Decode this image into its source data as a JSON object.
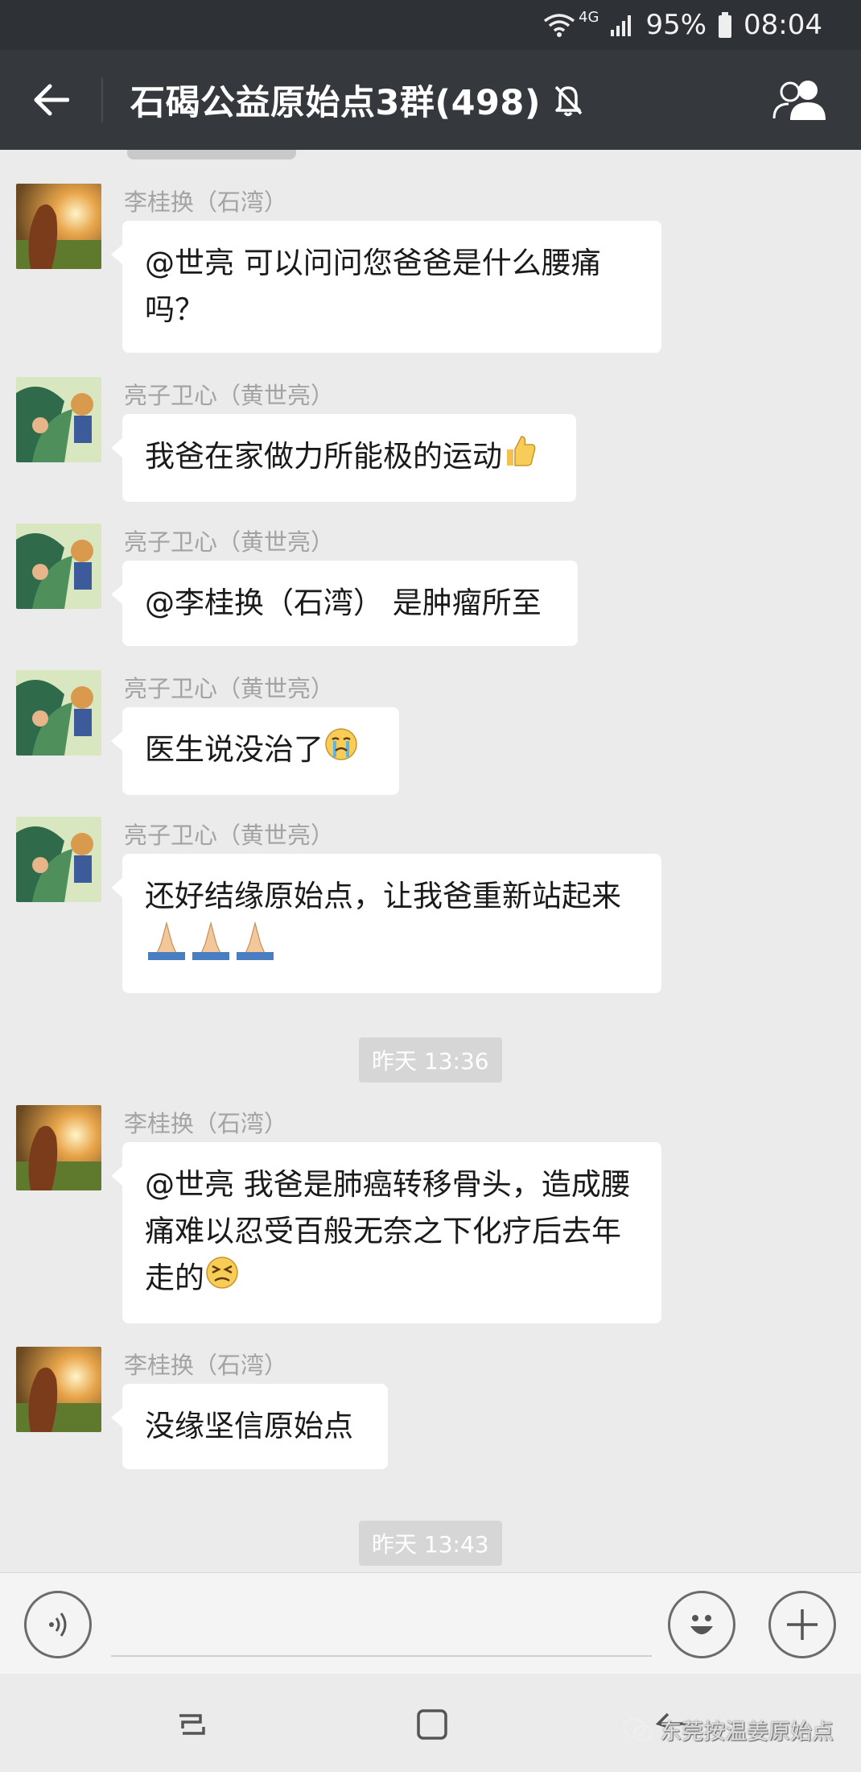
{
  "status_bar": {
    "network": "4G",
    "battery": "95%",
    "time": "08:04",
    "icons": [
      "wifi-icon",
      "signal-icon",
      "battery-icon"
    ]
  },
  "header": {
    "title": "石碣公益原始点3群(498)",
    "icons": [
      "back-arrow-icon",
      "mute-bell-icon",
      "group-members-icon"
    ]
  },
  "messages": [
    {
      "sender": "李桂换（石湾）",
      "avatar": "sunset-portrait",
      "text": "@世亮  可以问问您爸爸是什么腰痛吗？"
    },
    {
      "sender": "亮子卫心（黄世亮）",
      "avatar": "cartoon-leaves",
      "text": "我爸在家做力所能极的运动",
      "emoji": "thumbs-up"
    },
    {
      "sender": "亮子卫心（黄世亮）",
      "avatar": "cartoon-leaves",
      "text": "@李桂换（石湾）  是肿瘤所至"
    },
    {
      "sender": "亮子卫心（黄世亮）",
      "avatar": "cartoon-leaves",
      "text": "医生说没治了",
      "emoji": "crying-face"
    },
    {
      "sender": "亮子卫心（黄世亮）",
      "avatar": "cartoon-leaves",
      "text": "还好结缘原始点，让我爸重新站起来",
      "emoji": "folded-hands ×3"
    },
    {
      "sender": "李桂换（石湾）",
      "avatar": "sunset-portrait",
      "text": "@世亮  我爸是肺癌转移骨头，造成腰痛难以忍受百般无奈之下化疗后去年走的",
      "emoji": "persevering-face"
    },
    {
      "sender": "李桂换（石湾）",
      "avatar": "sunset-portrait",
      "text": "没缘坚信原始点"
    }
  ],
  "timestamps": [
    "昨天 13:36",
    "昨天 13:43"
  ],
  "input_bar": {
    "value": "",
    "icons": [
      "voice-icon",
      "emoji-icon",
      "plus-icon"
    ]
  },
  "nav_bar": {
    "icons": [
      "recent-apps-icon",
      "home-icon",
      "back-icon"
    ]
  },
  "watermark": "东莞按温姜原始点",
  "colors": {
    "header_bg": "#35383d",
    "chat_bg": "#ebebeb",
    "bubble_bg": "#ffffff",
    "sender_text": "#a3a3a3"
  }
}
